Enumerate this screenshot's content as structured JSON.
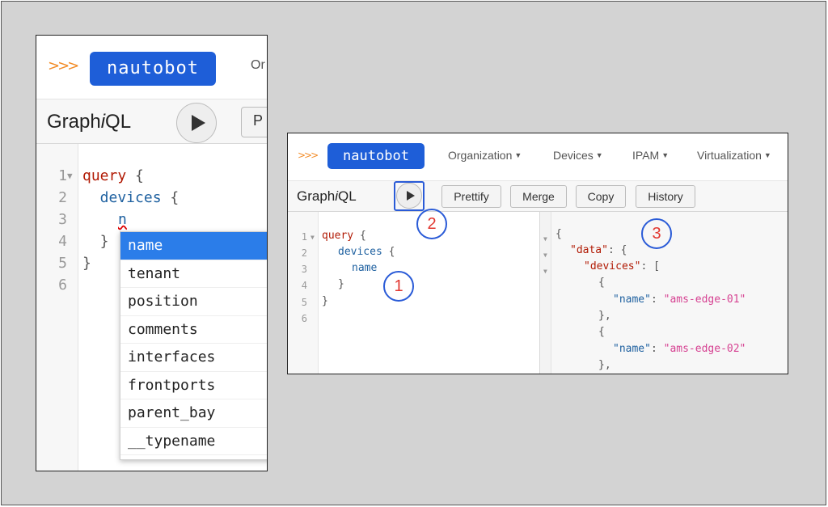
{
  "brand": {
    "logo_text": "nautobot",
    "chevrons": ">>>"
  },
  "zoom_panel": {
    "nav_partial": "Or",
    "title_prefix": "Graph",
    "title_i": "i",
    "title_suffix": "QL",
    "prettify_partial": "P",
    "line_numbers": [
      "1",
      "2",
      "3",
      "4",
      "5",
      "6"
    ],
    "code_lines": {
      "l1_kw": "query",
      "l1_brace": " {",
      "l2_field": "  devices",
      "l2_brace": " {",
      "l3_typed": "n",
      "l4": "  }",
      "l5": "}"
    },
    "autocomplete": [
      "name",
      "tenant",
      "position",
      "comments",
      "interfaces",
      "frontports",
      "parent_bay",
      "__typename"
    ]
  },
  "main_panel": {
    "nav_menu": [
      {
        "label": "Organization"
      },
      {
        "label": "Devices"
      },
      {
        "label": "IPAM"
      },
      {
        "label": "Virtualization"
      }
    ],
    "title_prefix": "Graph",
    "title_i": "i",
    "title_suffix": "QL",
    "toolbar": {
      "prettify": "Prettify",
      "merge": "Merge",
      "copy": "Copy",
      "history": "History"
    },
    "query_line_numbers": [
      "1",
      "2",
      "3",
      "4",
      "5",
      "6"
    ],
    "query": {
      "l1_kw": "query",
      "l1_brace": " {",
      "l2_field": "devices",
      "l2_brace": " {",
      "l3_field": "name",
      "l4": "}",
      "l5": "}"
    },
    "result": {
      "open": "{",
      "data_key": "\"data\"",
      "data_after": ": {",
      "devices_key": "\"devices\"",
      "devices_after": ": [",
      "obj_open": "{",
      "name_key": "\"name\"",
      "colon": ": ",
      "value_1": "\"ams-edge-01\"",
      "obj_close": "},",
      "value_2": "\"ams-edge-02\""
    }
  },
  "callouts": {
    "c1": "1",
    "c2": "2",
    "c3": "3"
  }
}
